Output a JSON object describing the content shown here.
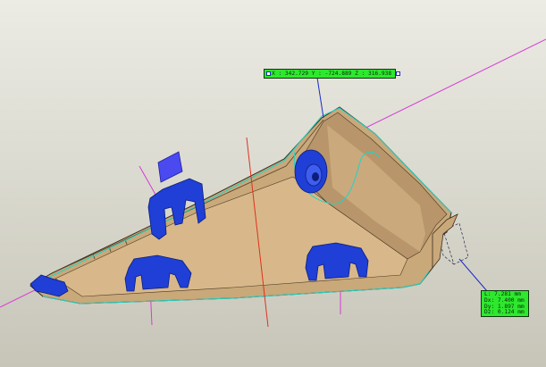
{
  "viewport": {
    "background_top": "#ecebe4",
    "background_bottom": "#c7c5b8"
  },
  "colors": {
    "part_fill": "#c9a87a",
    "part_dark": "#8c6e45",
    "clip_blue": "#1f3fd6",
    "edge_cyan": "#22d3c5",
    "axis_magenta": "#d63ad6",
    "axis_red": "#e0301e",
    "label_green": "#2ee82e",
    "leader_blue": "#1a2cc9"
  },
  "coordinate_label": {
    "text": "X : 342.729 Y : -724.889 Z : 316.938"
  },
  "measurement_box": {
    "lines": [
      "L: 7.281 mm",
      "Dx: 7.400 mm",
      "Dy: 1.897 mm",
      "Dz: 0.124 mm"
    ]
  }
}
